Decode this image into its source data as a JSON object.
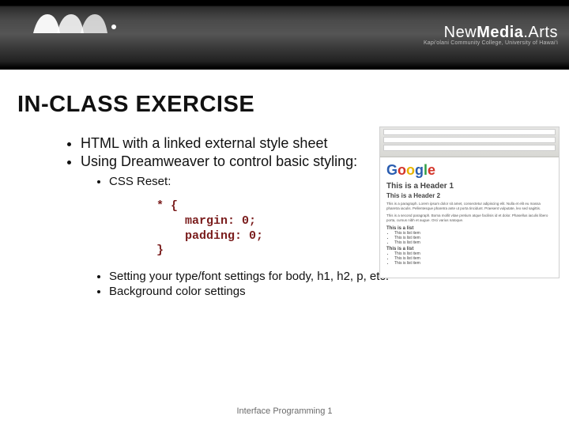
{
  "header": {
    "right_logo_main_light": "New",
    "right_logo_main_bold": "Media",
    "right_logo_main_light2": ".Arts",
    "right_logo_sub": "Kapi'olani Community College, University of Hawai'i"
  },
  "title": "IN-CLASS EXERCISE",
  "bullets_top": [
    "HTML with a linked external style sheet",
    "Using Dreamweaver to control basic styling:"
  ],
  "sub_bullet_1": "CSS Reset:",
  "code": "* {\n    margin: 0;\n    padding: 0;\n}",
  "bullets_bottom": [
    "Setting your type/font settings for body, h1, h2, p, etc.",
    "Background color settings"
  ],
  "thumb": {
    "logo_word": "Google",
    "h1": "This is a Header 1",
    "h2": "This is a Header 2",
    "para1": "This is a paragraph. Lorem ipsum dolor sit amet, consectetur adipiscing elit. Nulla et elit eu massa pharetra iaculis. Pellentesque pharetra ante ut porta tincidunt. Praesent vulputate, leo sed sagittis.",
    "para2": "This is a second paragraph. Boma mollit vitae pretium atque facilisis id et dolor. Phasellus iaculis libero porta, cursus nibh et augue. Orci varius natoque.",
    "list_label": "This is a list",
    "list_items": [
      "This is list item",
      "This is list item",
      "This is list item"
    ]
  },
  "footer": "Interface Programming 1"
}
